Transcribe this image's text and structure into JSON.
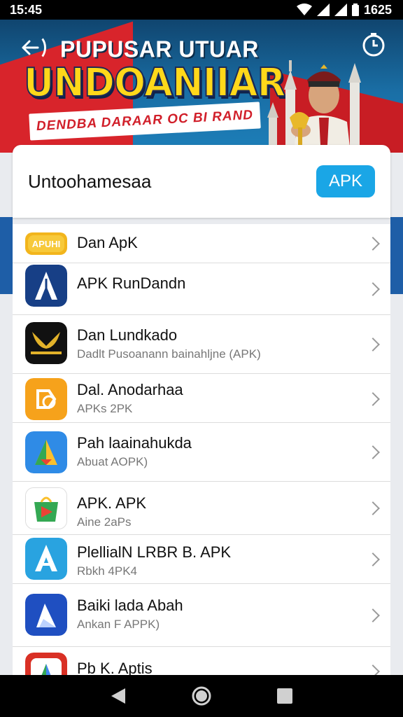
{
  "status_bar": {
    "time": "15:45",
    "right_time": "1625"
  },
  "banner": {
    "title_line1": "PUPUSAR UTUAR",
    "title_line2": "UNDOANIIAR",
    "tagline": "DENDBA DARAAR OC BI RAND"
  },
  "search_card": {
    "title": "Untoohamesaa",
    "button_label": "APK"
  },
  "apps": [
    {
      "title": "Dan ApK",
      "subtitle": "",
      "icon": "yellow-badge-icon",
      "badge_text": "APUHI"
    },
    {
      "title": "APK RunDandn",
      "subtitle": "",
      "icon": "blue-a-arrow-icon",
      "badge_text": ""
    },
    {
      "title": "Dan Lundkado",
      "subtitle": "Dadlt Pusoanann bainahljne (APK)",
      "icon": "gold-wings-icon",
      "badge_text": ""
    },
    {
      "title": "Dal. Anodarhaa",
      "subtitle": "APKs 2PK",
      "icon": "orange-clover-icon",
      "badge_text": ""
    },
    {
      "title": "Pah laainahukda",
      "subtitle": "Abuat AOPK)",
      "icon": "gradient-play-icon",
      "badge_text": ""
    },
    {
      "title": "APK. APK",
      "subtitle": "Aine 2aPs",
      "icon": "play-bag-icon",
      "badge_text": ""
    },
    {
      "title": "PlellialN LRBR B. APK",
      "subtitle": "Rbkh 4PK4",
      "icon": "light-blue-a-icon",
      "badge_text": ""
    },
    {
      "title": "Baiki lada Abah",
      "subtitle": "Ankan F APPK)",
      "icon": "blue-play-icon",
      "badge_text": ""
    },
    {
      "title": "Pb K. Aptis",
      "subtitle": "",
      "icon": "red-play-icon",
      "badge_text": ""
    }
  ],
  "colors": {
    "accent": "#1aa6e6",
    "banner_yellow": "#ffd81a",
    "banner_red": "#d8242b"
  }
}
